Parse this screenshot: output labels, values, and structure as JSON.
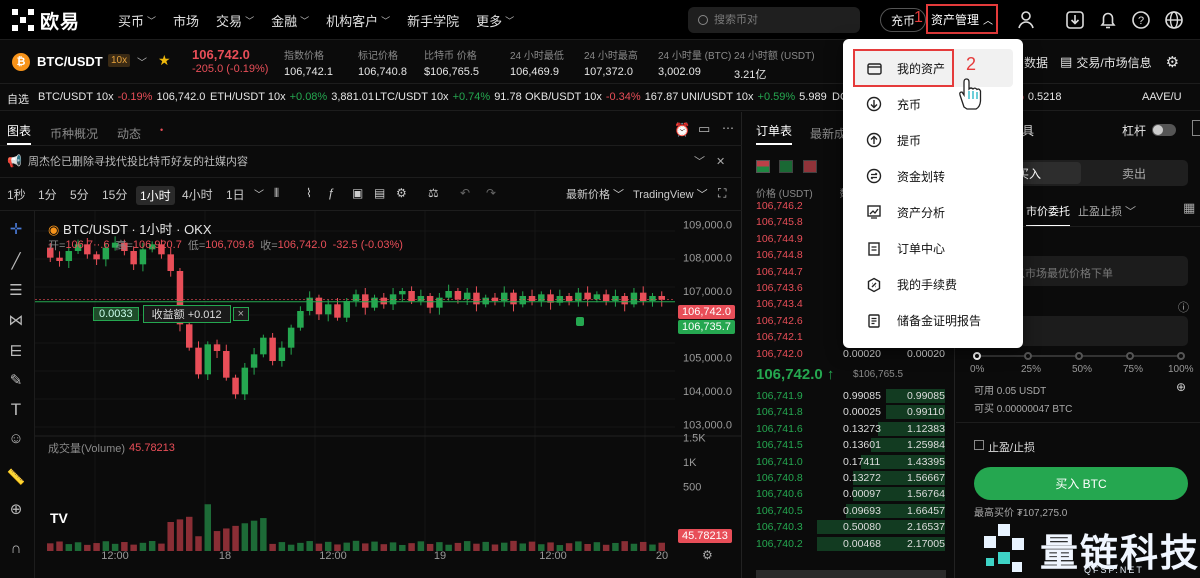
{
  "brand": {
    "name": "欧易"
  },
  "nav": {
    "items": [
      {
        "label": "买币",
        "caret": true
      },
      {
        "label": "市场",
        "caret": false
      },
      {
        "label": "交易",
        "caret": true
      },
      {
        "label": "金融",
        "caret": true
      },
      {
        "label": "机构客户",
        "caret": true
      },
      {
        "label": "新手学院",
        "caret": false
      },
      {
        "label": "更多",
        "caret": true
      }
    ]
  },
  "search": {
    "placeholder": "搜索币对"
  },
  "header": {
    "deposit": "充币",
    "asset_manage": "资产管理",
    "step1": "1",
    "step2": "2"
  },
  "pair": {
    "name": "BTC/USDT",
    "leverage": "10x",
    "last": "106,742.0",
    "change": "-205.0 (-0.19%)"
  },
  "stats": [
    {
      "label": "指数价格",
      "value": "106,742.1"
    },
    {
      "label": "标记价格",
      "value": "106,740.8"
    },
    {
      "label": "比特币 价格",
      "value": "$106,765.5"
    },
    {
      "label": "24 小时最低",
      "value": "106,469.9"
    },
    {
      "label": "24 小时最高",
      "value": "107,372.0"
    },
    {
      "label": "24 小时量 (BTC)",
      "value": "3,002.09"
    },
    {
      "label": "24 小时额 (USDT)",
      "value": "3.21亿"
    }
  ],
  "right_links": {
    "data": "数据",
    "info": "交易/市场信息"
  },
  "watchlist": {
    "label": "自选",
    "items": [
      {
        "pair": "BTC/USDT 10x",
        "chg": "-0.19%",
        "price": "106,742.0",
        "dir": "down"
      },
      {
        "pair": "ETH/USDT 10x",
        "chg": "+0.08%",
        "price": "3,881.01",
        "dir": "up"
      },
      {
        "pair": "LTC/USDT 10x",
        "chg": "+0.74%",
        "price": "91.78",
        "dir": "up"
      },
      {
        "pair": "OKB/USDT 10x",
        "chg": "-0.34%",
        "price": "167.87",
        "dir": "down"
      },
      {
        "pair": "UNI/USDT 10x",
        "chg": "+0.59%",
        "price": "5.989",
        "dir": "up"
      },
      {
        "pair": "DC",
        "chg": "",
        "price": "",
        "dir": "up"
      },
      {
        "pair": "",
        "chg": "-0.42%",
        "price": "0.5218",
        "dir": "down"
      },
      {
        "pair": "AAVE/U",
        "chg": "",
        "price": "",
        "dir": "up"
      }
    ]
  },
  "chart_tabs": [
    "图表",
    "币种概况",
    "动态"
  ],
  "notice": "周杰伦已删除寻找代投比特币好友的社媒内容",
  "timeframes": [
    "1秒",
    "1分",
    "5分",
    "15分",
    "1小时",
    "4小时",
    "1日"
  ],
  "toolbar": {
    "price_type": "最新价格",
    "view": "TradingView"
  },
  "chart": {
    "title": "BTC/USDT · 1小时 · OKX",
    "ohlc": {
      "open_label": "开=",
      "open": "106,7··.6",
      "high_label": "高=",
      "high": "106,920.7",
      "low_label": "低=",
      "low": "106,709.8",
      "close_label": "收=",
      "close": "106,742.0",
      "chg": "-32.5 (-0.03%)"
    },
    "pnl": {
      "qty": "0.0033",
      "label": "收益额 +0.012",
      "close": "×"
    },
    "price_axis": [
      "109,000.0",
      "108,000.0",
      "107,000.0",
      "105,000.0",
      "104,000.0",
      "103,000.0"
    ],
    "price_tags": {
      "last": "106,742.0",
      "entry": "106,735.7",
      "vol": "45.78213"
    },
    "vol_axis": [
      "1.5K",
      "1K",
      "500"
    ],
    "vol_label": "成交量(Volume)",
    "vol_value": "45.78213",
    "time_axis": [
      "12:00",
      "18",
      "12:00",
      "19",
      "12:00",
      "20"
    ]
  },
  "orderbook": {
    "tabs": [
      "订单表",
      "最新成"
    ],
    "price_header": "价格 (USDT)",
    "qty_header": "数",
    "asks": [
      {
        "p": "106,746.2"
      },
      {
        "p": "106,745.8"
      },
      {
        "p": "106,744.9"
      },
      {
        "p": "106,744.8"
      },
      {
        "p": "106,744.7"
      },
      {
        "p": "106,743.6"
      },
      {
        "p": "106,743.4"
      },
      {
        "p": "106,742.6"
      },
      {
        "p": "106,742.1"
      },
      {
        "p": "106,742.0",
        "q": "0.00020",
        "t": "0.00020"
      }
    ],
    "mid": "106,742.0 ↑",
    "mid_usd": "$106,765.5",
    "bids": [
      {
        "p": "106,741.9",
        "q": "0.99085",
        "t": "0.99085",
        "d": 0.46
      },
      {
        "p": "106,741.8",
        "q": "0.00025",
        "t": "0.99110",
        "d": 0.46
      },
      {
        "p": "106,741.6",
        "q": "0.13273",
        "t": "1.12383",
        "d": 0.52
      },
      {
        "p": "106,741.5",
        "q": "0.13601",
        "t": "1.25984",
        "d": 0.58
      },
      {
        "p": "106,741.0",
        "q": "0.17411",
        "t": "1.43395",
        "d": 0.66
      },
      {
        "p": "106,740.8",
        "q": "0.13272",
        "t": "1.56667",
        "d": 0.72
      },
      {
        "p": "106,740.6",
        "q": "0.00097",
        "t": "1.56764",
        "d": 0.72
      },
      {
        "p": "106,740.5",
        "q": "0.09693",
        "t": "1.66457",
        "d": 0.77
      },
      {
        "p": "106,740.3",
        "q": "0.50080",
        "t": "2.16537",
        "d": 1.0
      },
      {
        "p": "106,740.2",
        "q": "0.00468",
        "t": "2.17005",
        "d": 1.0
      }
    ]
  },
  "trade": {
    "tools": "具",
    "leverage": "杠杆",
    "buy_tab": "买入",
    "sell_tab": "卖出",
    "order_types": {
      "market": "市价委托",
      "tpsl": "止盈止损"
    },
    "price_hint": "以市场最优价格下单",
    "pct": [
      "0%",
      "25%",
      "50%",
      "75%",
      "100%"
    ],
    "available_label": "可用",
    "available": "0.05 USDT",
    "can_buy_label": "可买",
    "can_buy": "0.00000047 BTC",
    "tpsl_label": "止盈/止损",
    "buy_btn": "买入 BTC",
    "max_buy": "最高买价 ₮107,275.0"
  },
  "dropdown": {
    "items": [
      {
        "label": "我的资产",
        "icon": "wallet-icon"
      },
      {
        "label": "充币",
        "icon": "deposit-icon"
      },
      {
        "label": "提币",
        "icon": "withdraw-icon"
      },
      {
        "label": "资金划转",
        "icon": "transfer-icon"
      },
      {
        "label": "资产分析",
        "icon": "analysis-icon"
      },
      {
        "label": "订单中心",
        "icon": "order-icon"
      },
      {
        "label": "我的手续费",
        "icon": "fee-icon"
      },
      {
        "label": "储备金证明报告",
        "icon": "report-icon"
      }
    ]
  },
  "watermark": {
    "text": "量链科技",
    "sub": "QFSP.NET"
  },
  "colors": {
    "up": "#25a750",
    "down": "#e84e58",
    "highlight": "#e53b3b"
  }
}
